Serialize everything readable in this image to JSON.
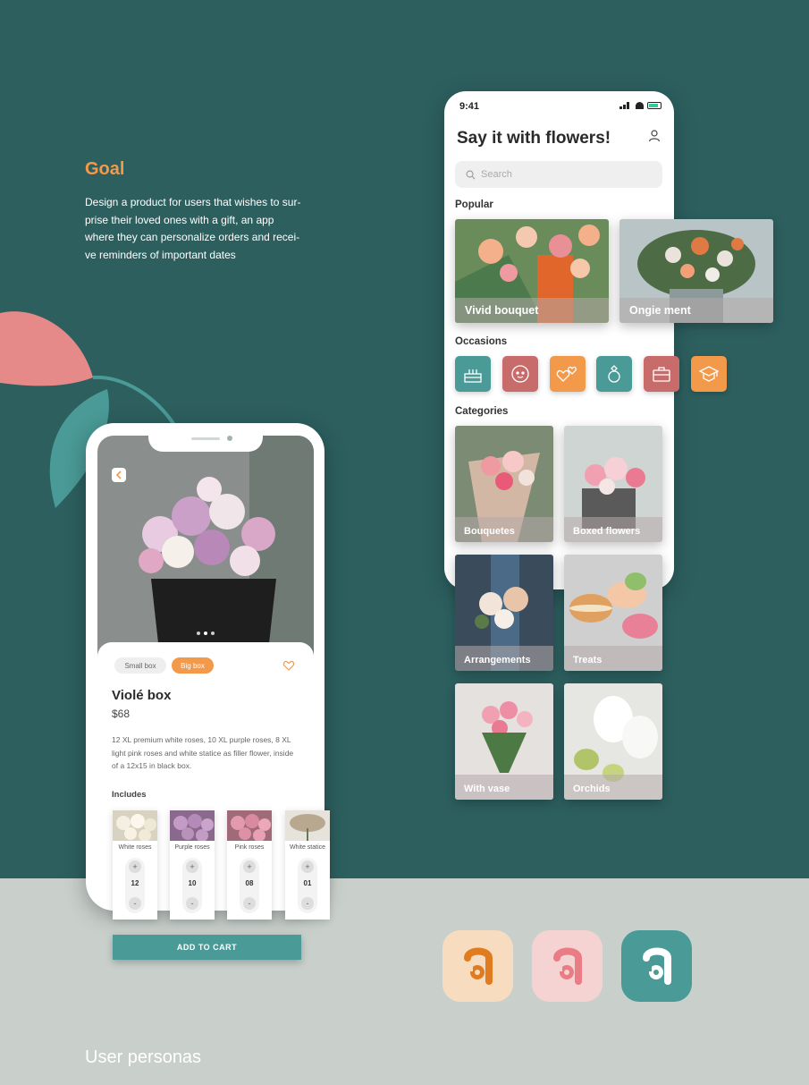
{
  "goal": {
    "title": "Goal",
    "lines": [
      "Design a product for users that wishes to sur-",
      "prise their loved ones with a gift, an app",
      "where they can personalize orders and recei-",
      "ve reminders of important dates"
    ]
  },
  "home": {
    "status_time": "9:41",
    "title": "Say it with flowers!",
    "search_placeholder": "Search",
    "popular_label": "Popular",
    "popular": [
      {
        "label": "Vivid bouquet"
      },
      {
        "label": "Ongie ment"
      }
    ],
    "occasions_label": "Occasions",
    "occasions": [
      {
        "icon": "birthday-cake-icon",
        "color": "#4a9a97"
      },
      {
        "icon": "baby-face-icon",
        "color": "#c86b6b"
      },
      {
        "icon": "hearts-icon",
        "color": "#f2994a"
      },
      {
        "icon": "ring-icon",
        "color": "#4a9a97"
      },
      {
        "icon": "briefcase-icon",
        "color": "#c86b6b"
      },
      {
        "icon": "graduation-cap-icon",
        "color": "#f2994a"
      }
    ],
    "categories_label": "Categories",
    "categories": [
      {
        "label": "Bouquetes"
      },
      {
        "label": "Boxed flowers"
      },
      {
        "label": "Arrangements"
      },
      {
        "label": "Treats"
      },
      {
        "label": "With vase"
      },
      {
        "label": "Orchids"
      }
    ]
  },
  "product": {
    "size_small": "Small box",
    "size_big": "Big box",
    "title": "Violé box",
    "price": "$68",
    "description": "12 XL premium white roses, 10 XL purple roses, 8 XL light pink roses and white statice as filler flower, inside of a 12x15 in black box.",
    "includes_label": "Includes",
    "includes": [
      {
        "label": "White roses",
        "qty": "12"
      },
      {
        "label": "Purple roses",
        "qty": "10"
      },
      {
        "label": "Pink roses",
        "qty": "08"
      },
      {
        "label": "White statice",
        "qty": "01"
      }
    ],
    "add_to_cart": "ADD TO CART"
  },
  "app_icons": [
    {
      "bg": "#f7dcc0",
      "fg": "#e07b1f"
    },
    {
      "bg": "#f6d3d3",
      "fg": "#e97c84"
    },
    {
      "bg": "#4a9a97",
      "fg": "#ffffff"
    }
  ],
  "personas_heading": "User personas"
}
